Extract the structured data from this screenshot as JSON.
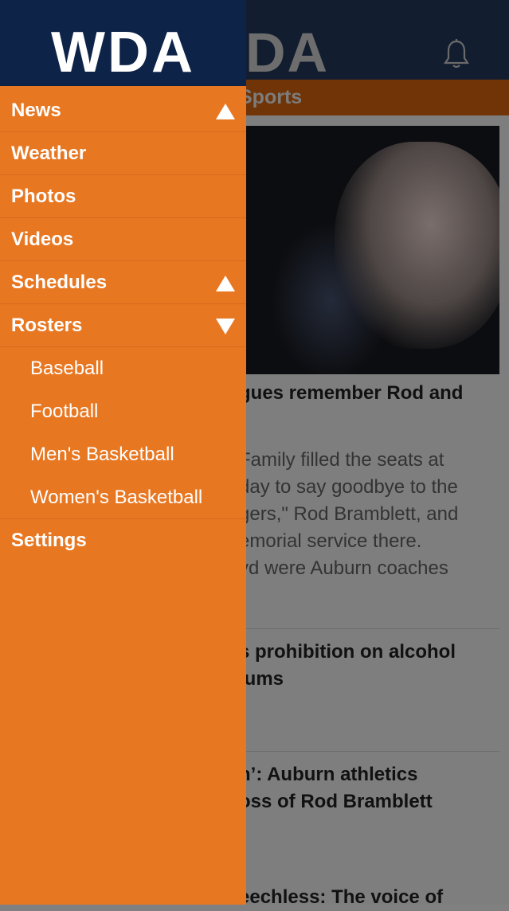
{
  "drawer": {
    "logo": "WDA",
    "menu": [
      {
        "label": "News",
        "expand": "up"
      },
      {
        "label": "Weather"
      },
      {
        "label": "Photos"
      },
      {
        "label": "Videos"
      },
      {
        "label": "Schedules",
        "expand": "up"
      },
      {
        "label": "Rosters",
        "expand": "down"
      }
    ],
    "rosters_sub": [
      "Baseball",
      "Football",
      "Men's Basketball",
      "Women's Basketball"
    ],
    "settings_label": "Settings"
  },
  "background": {
    "logo_fragment": "DA",
    "section_fragment": "Sports",
    "articles": [
      {
        "title_lines": [
          "gues remember Rod and"
        ],
        "snippet_lines": [
          "Family filled the seats at",
          "day to say goodbye to the",
          "gers,\" Rod Bramblett, and",
          "emorial service there.",
          "vd were Auburn coaches"
        ]
      },
      {
        "title_lines": [
          "s prohibition on alcohol",
          "iums"
        ]
      },
      {
        "title_lines": [
          "n’: Auburn athletics",
          "oss of Rod Bramblett"
        ]
      },
      {
        "title_lines": [
          "eechless: The voice of"
        ]
      }
    ]
  },
  "colors": {
    "drawer_bg": "#e87722",
    "drawer_header": "#0d2348",
    "overlay_header": "#131d30"
  }
}
